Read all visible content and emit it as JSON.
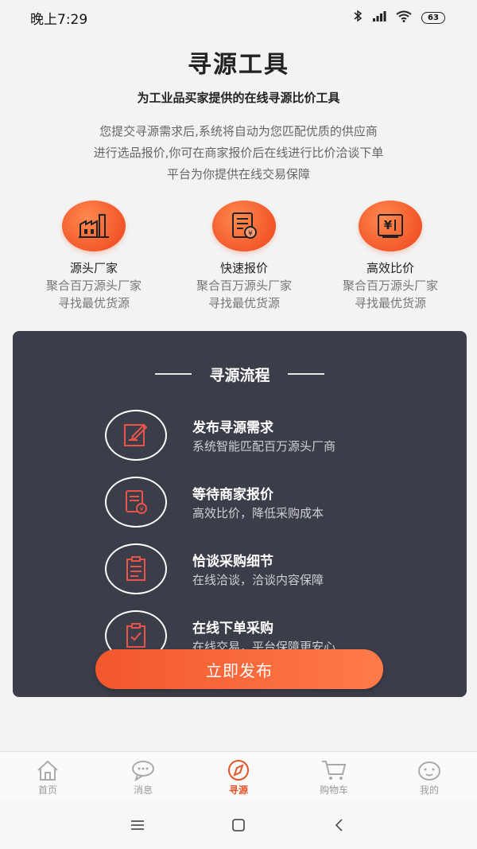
{
  "status_bar": {
    "time": "晚上7:29",
    "battery": "63"
  },
  "header": {
    "title": "寻源工具",
    "subtitle": "为工业品买家提供的在线寻源比价工具",
    "intro": [
      "您提交寻源需求后,系统将自动为您匹配优质的供应商",
      "进行选品报价,你可在商家报价后在线进行比价洽谈下单",
      "平台为你提供在线交易保障"
    ]
  },
  "features": [
    {
      "icon": "factory-icon",
      "name": "源头厂家",
      "desc1": "聚合百万源头厂家",
      "desc2": "寻找最优货源"
    },
    {
      "icon": "quote-document-icon",
      "name": "快速报价",
      "desc1": "聚合百万源头厂家",
      "desc2": "寻找最优货源"
    },
    {
      "icon": "price-compare-icon",
      "name": "高效比价",
      "desc1": "聚合百万源头厂家",
      "desc2": "寻找最优货源"
    }
  ],
  "process": {
    "title": "寻源流程",
    "steps": [
      {
        "icon": "edit-form-icon",
        "title": "发布寻源需求",
        "desc": "系统智能匹配百万源头厂商"
      },
      {
        "icon": "quote-icon",
        "title": "等待商家报价",
        "desc": "高效比价，降低采购成本"
      },
      {
        "icon": "clipboard-icon",
        "title": "恰谈采购细节",
        "desc": "在线洽谈，洽谈内容保障"
      },
      {
        "icon": "checked-clipboard-icon",
        "title": "在线下单采购",
        "desc": "在线交易，平台保障更安心"
      }
    ],
    "button_label": "立即发布"
  },
  "tabs": [
    {
      "icon": "home-icon",
      "label": "首页",
      "active": false
    },
    {
      "icon": "message-icon",
      "label": "消息",
      "active": false
    },
    {
      "icon": "compass-icon",
      "label": "寻源",
      "active": true
    },
    {
      "icon": "cart-icon",
      "label": "购物车",
      "active": false
    },
    {
      "icon": "profile-icon",
      "label": "我的",
      "active": false
    }
  ],
  "colors": {
    "accent": "#f2572a",
    "card": "#3b3d49",
    "active_tab": "#e8542a"
  }
}
